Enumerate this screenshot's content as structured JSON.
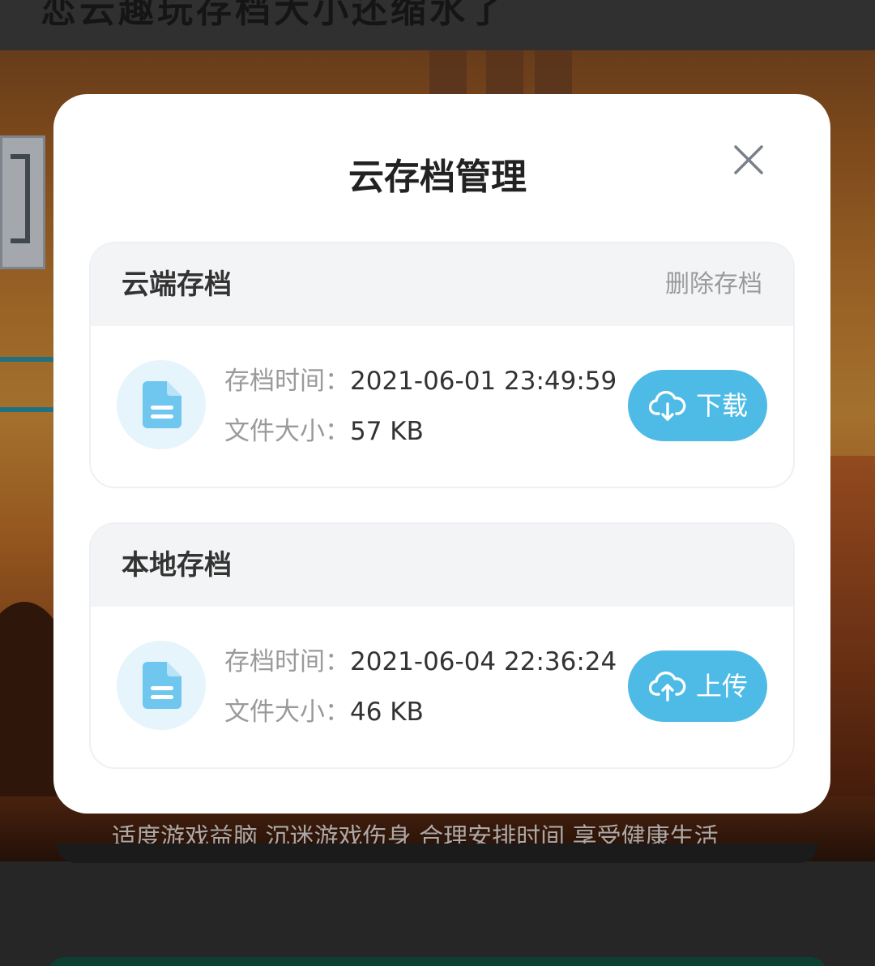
{
  "background": {
    "page_title": "恋云趣玩存档大小还缩水了",
    "slogan": "适度游戏益脑 沉迷游戏伤身 合理安排时间 享受健康生活"
  },
  "dialog": {
    "title": "云存档管理",
    "close_icon": "close-icon",
    "cloud_section": {
      "title": "云端存档",
      "delete_label": "删除存档",
      "time_label": "存档时间：",
      "time_value": "2021-06-01 23:49:59",
      "size_label": "文件大小：",
      "size_value": "57 KB",
      "file_icon": "file-icon",
      "button_icon": "cloud-download-icon",
      "button_label": "下载"
    },
    "local_section": {
      "title": "本地存档",
      "time_label": "存档时间：",
      "time_value": "2021-06-04 22:36:24",
      "size_label": "文件大小：",
      "size_value": "46 KB",
      "file_icon": "file-icon",
      "button_icon": "cloud-upload-icon",
      "button_label": "上传"
    }
  },
  "colors": {
    "accent": "#4dbbe6",
    "icon_bg": "#e6f4fb",
    "section_header_bg": "#f3f4f6",
    "title_text": "#222222",
    "muted_text": "#9a9a9a"
  }
}
